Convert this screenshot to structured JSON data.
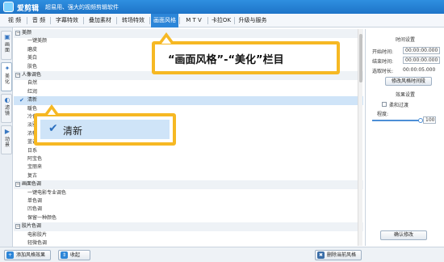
{
  "app": {
    "name": "爱剪辑",
    "slogan": "超易用、强大的视频剪辑软件"
  },
  "menu": [
    "视 频",
    "音 频",
    "字幕特效",
    "叠加素材",
    "转场特效",
    "画面风格",
    "M T V",
    "卡拉OK",
    "升级与服务"
  ],
  "active_menu_index": 5,
  "left_tabs": [
    {
      "label": "画面",
      "icon": "picture-icon"
    },
    {
      "label": "美化",
      "icon": "sparkle-icon"
    },
    {
      "label": "滤镜",
      "icon": "filter-icon"
    },
    {
      "label": "动景",
      "icon": "motion-icon"
    }
  ],
  "active_left_tab_index": 1,
  "list": [
    {
      "type": "cat",
      "label": "美颜"
    },
    {
      "type": "item",
      "label": "一键美颜"
    },
    {
      "type": "item",
      "label": "磨皮"
    },
    {
      "type": "item",
      "label": "美白"
    },
    {
      "type": "item",
      "label": "肤色"
    },
    {
      "type": "cat",
      "label": "人像调色"
    },
    {
      "type": "item",
      "label": "自然"
    },
    {
      "type": "item",
      "label": "红润"
    },
    {
      "type": "item",
      "label": "清新",
      "selected": true
    },
    {
      "type": "item",
      "label": "暖色"
    },
    {
      "type": "item",
      "label": "冷色"
    },
    {
      "type": "item",
      "label": "淡雅"
    },
    {
      "type": "item",
      "label": "浓郁"
    },
    {
      "type": "item",
      "label": "蓝调"
    },
    {
      "type": "item",
      "label": "日系"
    },
    {
      "type": "item",
      "label": "阿宝色"
    },
    {
      "type": "item",
      "label": "宝丽来"
    },
    {
      "type": "item",
      "label": "复古"
    },
    {
      "type": "cat",
      "label": "画面色调"
    },
    {
      "type": "item",
      "label": "一键电影专业调色"
    },
    {
      "type": "item",
      "label": "单色调"
    },
    {
      "type": "item",
      "label": "凹色调"
    },
    {
      "type": "item",
      "label": "保留一种颜色"
    },
    {
      "type": "cat",
      "label": "胶片色调"
    },
    {
      "type": "item",
      "label": "电影胶片"
    },
    {
      "type": "item",
      "label": "轻微色调"
    }
  ],
  "right_panel": {
    "time_title": "时间设置",
    "start_label": "开始时间:",
    "start_value": "00:00:00.000",
    "end_label": "结束时间:",
    "end_value": "00:00:00.000",
    "duration_label": "选取时长:",
    "duration_value": "00:00:05.000",
    "modify_time_button": "修改风格时间段",
    "effect_title": "效果设置",
    "fade_label": "柔和过渡",
    "fade_checked": false,
    "degree_label": "程度:",
    "degree_value": "100",
    "degree_fraction": 1.0,
    "confirm_button": "确认修改"
  },
  "bottom": {
    "add_button": "添加风格效果",
    "collect_button": "收起",
    "delete_button": "删除当前风格"
  },
  "callout_top": "“画面风格”-“美化”栏目",
  "callout_item": "清新",
  "colors": {
    "accent": "#2d86d8",
    "callout": "#f6b823",
    "selection": "#cfe4f8"
  }
}
